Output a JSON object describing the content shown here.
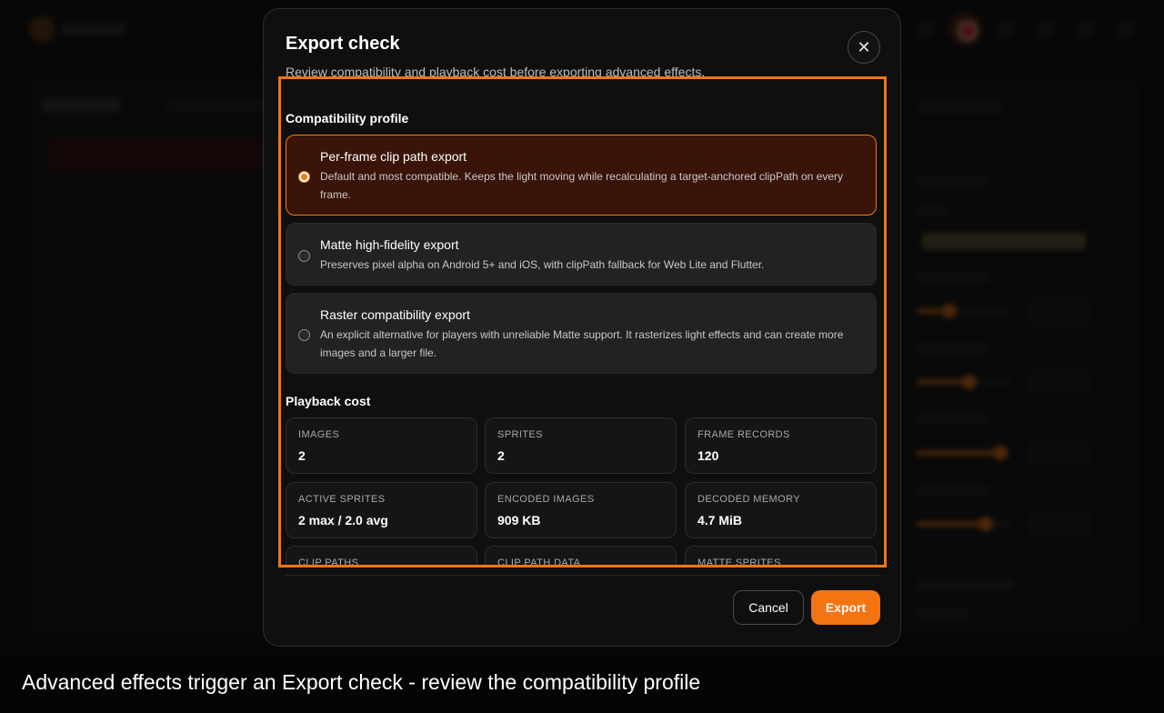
{
  "modal": {
    "title": "Export check",
    "subtitle": "Review compatibility and playback cost before exporting advanced effects.",
    "close_icon": "close-icon",
    "compat_heading": "Compatibility profile",
    "options": [
      {
        "title": "Per-frame clip path export",
        "description": "Default and most compatible. Keeps the light moving while recalculating a target-anchored clipPath on every frame.",
        "selected": true
      },
      {
        "title": "Matte high-fidelity export",
        "description": "Preserves pixel alpha on Android 5+ and iOS, with clipPath fallback for Web Lite and Flutter.",
        "selected": false
      },
      {
        "title": "Raster compatibility export",
        "description": "An explicit alternative for players with unreliable Matte support. It rasterizes light effects and can create more images and a larger file.",
        "selected": false
      }
    ],
    "cost_heading": "Playback cost",
    "stats": [
      {
        "label": "IMAGES",
        "value": "2"
      },
      {
        "label": "SPRITES",
        "value": "2"
      },
      {
        "label": "FRAME RECORDS",
        "value": "120"
      },
      {
        "label": "ACTIVE SPRITES",
        "value": "2 max / 2.0 avg"
      },
      {
        "label": "ENCODED IMAGES",
        "value": "909 KB"
      },
      {
        "label": "DECODED MEMORY",
        "value": "4.7 MiB"
      },
      {
        "label": "CLIP PATHS",
        "value": ""
      },
      {
        "label": "CLIP PATH DATA",
        "value": ""
      },
      {
        "label": "MATTE SPRITES",
        "value": ""
      }
    ],
    "cancel_label": "Cancel",
    "export_label": "Export"
  },
  "caption": "Advanced effects trigger an Export check - review the compatibility profile",
  "colors": {
    "accent": "#f47414",
    "selected_bg": "#3a1409",
    "modal_bg": "#0f0f10"
  }
}
